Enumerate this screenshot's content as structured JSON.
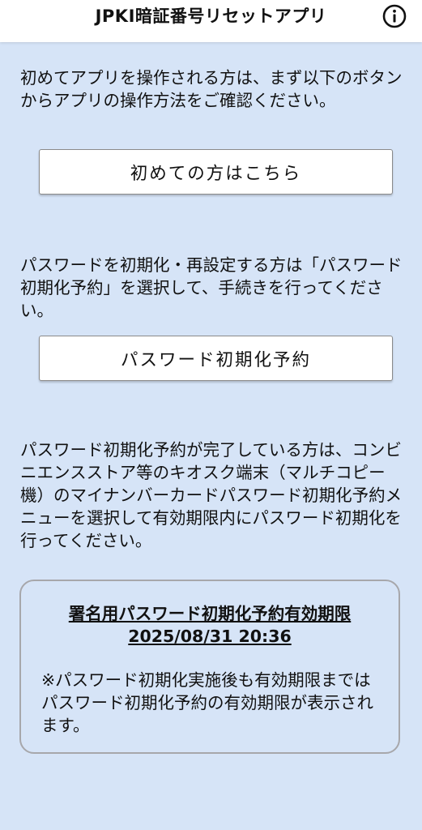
{
  "header": {
    "title": "JPKI暗証番号リセットアプリ",
    "info_icon": "info-icon"
  },
  "sections": {
    "intro_text": "初めてアプリを操作される方は、まず以下のボタンからアプリの操作方法をご確認ください。",
    "first_time_button": "初めての方はこちら",
    "reset_text": "パスワードを初期化・再設定する方は「パスワード初期化予約」を選択して、手続きを行ってください。",
    "reservation_button": "パスワード初期化予約",
    "completed_text": "パスワード初期化予約が完了している方は、コンビニエンスストア等のキオスク端末（マルチコピー機）のマイナンバーカードパスワード初期化予約メニューを選択して有効期限内にパスワード初期化を行ってください。"
  },
  "expiry_card": {
    "title": "署名用パスワード初期化予約有効期限",
    "datetime": "2025/08/31 20:36",
    "note": "※パスワード初期化実施後も有効期限まではパスワード初期化予約の有効期限が表示されます。"
  },
  "colors": {
    "background": "#d6e4f7",
    "header": "#ffffff",
    "button": "#ffffff",
    "card_border": "#a7a7ab"
  }
}
